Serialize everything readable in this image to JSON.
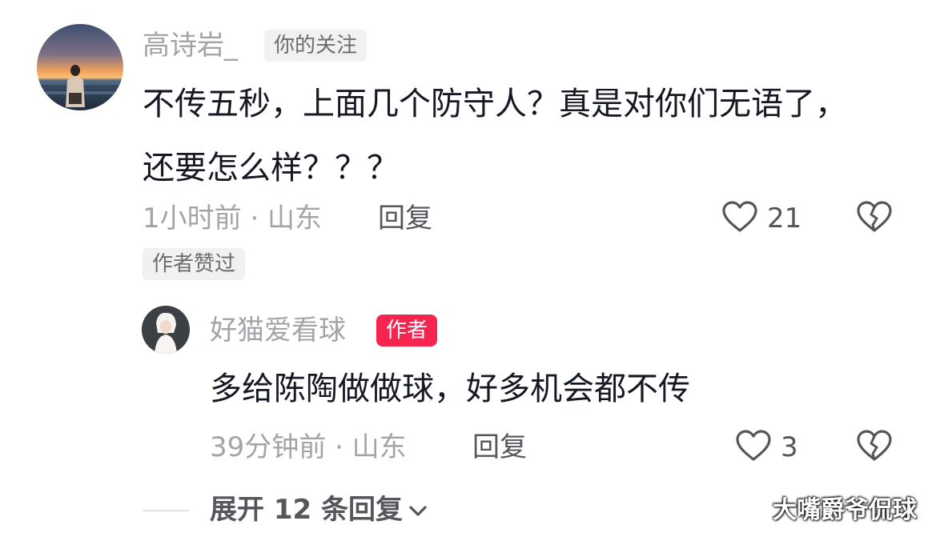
{
  "main_comment": {
    "username": "高诗岩_",
    "follow_badge": "你的关注",
    "text": "不传五秒，上面几个防守人？真是对你们无语了，还要怎么样？？？",
    "meta": "1小时前 · 山东",
    "reply_label": "回复",
    "like_count": "21",
    "author_liked_badge": "作者赞过",
    "avatar_icon": "sunset-avatar"
  },
  "reply_comment": {
    "username": "好猫爱看球",
    "author_badge": "作者",
    "text": "多给陈陶做做球，好多机会都不传",
    "meta": "39分钟前 · 山东",
    "reply_label": "回复",
    "like_count": "3",
    "avatar_icon": "portrait-avatar"
  },
  "expand": {
    "label": "展开 12 条回复",
    "icon": "chevron-down-icon"
  },
  "watermark": "大嘴爵爷侃球",
  "colors": {
    "text_primary": "#161823",
    "text_secondary": "#a3a4a8",
    "author_badge_bg": "#f6254f",
    "chip_bg": "#f1f1f2"
  }
}
